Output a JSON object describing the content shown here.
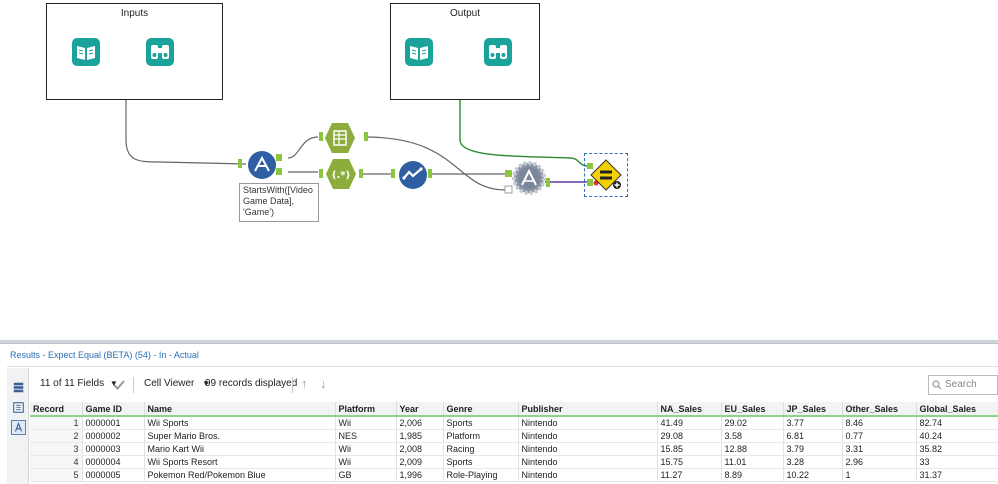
{
  "workflow": {
    "containers": [
      {
        "title": "Inputs"
      },
      {
        "title": "Output"
      }
    ],
    "annotation": "StartsWith([Video\nGame Data],\n'Game')",
    "tools": [
      {
        "name": "input-book-icon"
      },
      {
        "name": "browse-binoculars-icon"
      },
      {
        "name": "filter-tool-icon"
      },
      {
        "name": "select-tool-icon"
      },
      {
        "name": "regex-tool-icon"
      },
      {
        "name": "data-cleanse-tool-icon"
      },
      {
        "name": "test-gear-icon"
      },
      {
        "name": "expect-equal-icon"
      }
    ],
    "colors": {
      "tool_teal": "#1aa39b",
      "tool_blue": "#2e5fa3",
      "tool_olive": "#8cac3c",
      "tool_gray": "#7a8699",
      "expect_yellow": "#f5d100",
      "connector_green": "#2e8b2e",
      "connector_purple": "#5b3fa0"
    }
  },
  "results": {
    "title": "Results - Expect Equal (BETA) (54) - In - Actual",
    "fields_label": "11 of 11 Fields",
    "viewer_label": "Cell Viewer",
    "records_label": "99 records displayed",
    "search_placeholder": "Search",
    "columns": [
      "Record",
      "Game ID",
      "Name",
      "Platform",
      "Year",
      "Genre",
      "Publisher",
      "NA_Sales",
      "EU_Sales",
      "JP_Sales",
      "Other_Sales",
      "Global_Sales"
    ],
    "rows": [
      [
        "1",
        "0000001",
        "Wii Sports",
        "Wii",
        "2,006",
        "Sports",
        "Nintendo",
        "41.49",
        "29.02",
        "3.77",
        "8.46",
        "82.74"
      ],
      [
        "2",
        "0000002",
        "Super Mario Bros.",
        "NES",
        "1,985",
        "Platform",
        "Nintendo",
        "29.08",
        "3.58",
        "6.81",
        "0.77",
        "40.24"
      ],
      [
        "3",
        "0000003",
        "Mario Kart Wii",
        "Wii",
        "2,008",
        "Racing",
        "Nintendo",
        "15.85",
        "12.88",
        "3.79",
        "3.31",
        "35.82"
      ],
      [
        "4",
        "0000004",
        "Wii Sports Resort",
        "Wii",
        "2,009",
        "Sports",
        "Nintendo",
        "15.75",
        "11.01",
        "3.28",
        "2.96",
        "33"
      ],
      [
        "5",
        "0000005",
        "Pokemon Red/Pokemon Blue",
        "GB",
        "1,996",
        "Role-Playing",
        "Nintendo",
        "11.27",
        "8.89",
        "10.22",
        "1",
        "31.37"
      ]
    ]
  }
}
